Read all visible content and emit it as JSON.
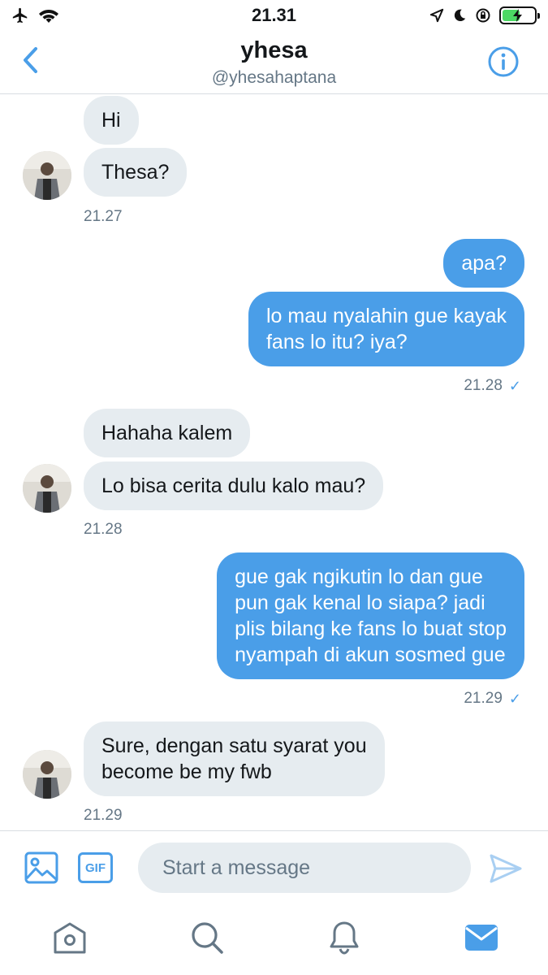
{
  "status_bar": {
    "time": "21.31",
    "left_icons": [
      "airplane-icon",
      "wifi-icon"
    ],
    "right_icons": [
      "location-icon",
      "moon-icon",
      "orientation-lock-icon",
      "battery-charging-icon"
    ],
    "battery_level": 0.55
  },
  "header": {
    "name": "yhesa",
    "handle": "@yhesahaptana",
    "icons": [
      "chevron-left-icon",
      "info-icon"
    ]
  },
  "messages": [
    {
      "from": "them",
      "text": "Hi"
    },
    {
      "from": "them",
      "text": "Thesa?"
    },
    {
      "from": "them",
      "time": "21.27"
    },
    {
      "from": "me",
      "text": "apa?"
    },
    {
      "from": "me",
      "text": "lo mau nyalahin gue kayak\nfans lo itu? iya?"
    },
    {
      "from": "me",
      "time": "21.28",
      "status": "✓"
    },
    {
      "from": "them",
      "text": "Hahaha kalem"
    },
    {
      "from": "them",
      "text": "Lo bisa cerita dulu kalo mau?"
    },
    {
      "from": "them",
      "time": "21.28"
    },
    {
      "from": "me",
      "text": "gue gak ngikutin lo dan gue\npun gak kenal lo siapa? jadi\nplis bilang ke fans lo buat stop\nnyampah di akun sosmed gue"
    },
    {
      "from": "me",
      "time": "21.29",
      "status": "✓"
    },
    {
      "from": "them",
      "text": "Sure, dengan satu syarat you\nbecome be my fwb"
    },
    {
      "from": "them",
      "time": "21.29"
    }
  ],
  "composer": {
    "placeholder": "Start a message",
    "gif_label": "GIF",
    "icons": [
      "image-icon",
      "send-icon"
    ]
  },
  "tabbar": {
    "items": [
      "home-icon",
      "search-icon",
      "notifications-icon",
      "messages-icon"
    ],
    "active": "messages-icon"
  },
  "colors": {
    "accent": "#4a9ee8",
    "incoming_bubble": "#e6ecf0",
    "secondary_text": "#657786"
  }
}
